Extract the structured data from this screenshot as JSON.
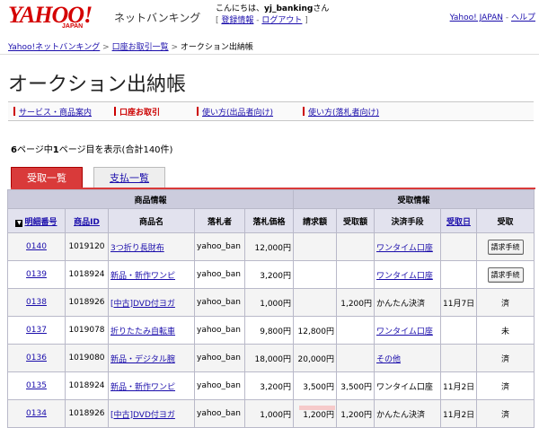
{
  "header": {
    "logo_text": "YAHOO!",
    "logo_sub": "JAPAN",
    "service_name": "ネットバンキング",
    "greeting_prefix": "こんにちは、",
    "user_name": "yj_banking",
    "greeting_suffix": "さん",
    "register_info": "登録情報",
    "logout": "ログアウト",
    "yahoo_japan_link": "Yahoo! JAPAN",
    "help_link": "ヘルプ"
  },
  "breadcrumb": {
    "home": "Yahoo!ネットバンキング",
    "account_list": "口座お取引一覧",
    "current": "オークション出納帳"
  },
  "page_title": "オークション出納帳",
  "menu": [
    {
      "label": "サービス・商品案内"
    },
    {
      "label": "口座お取引"
    },
    {
      "label": "使い方(出品者向け)"
    },
    {
      "label": "使い方(落札者向け)"
    }
  ],
  "page_info": {
    "total_pages": "6",
    "t1": "ページ中",
    "current_page": "1",
    "t2": "ページ目を表示(合計140件)"
  },
  "tabs": {
    "receipt": "受取一覧",
    "payment": "支払一覧"
  },
  "table": {
    "group_product": "商品情報",
    "group_receipt": "受取情報",
    "col_ledger": "明細番号",
    "col_product_id": "商品ID",
    "col_product_name": "商品名",
    "col_bidder": "落札者",
    "col_price": "落札価格",
    "col_billed": "請求額",
    "col_received": "受取額",
    "col_method": "決済手段",
    "col_date": "受取日",
    "col_status": "受取",
    "sort_marker": "▼",
    "rows": [
      {
        "ledger": "0140",
        "pid": "1019120",
        "name": "3つ折り長財布",
        "bidder": "yahoo_ban",
        "price": "12,000円",
        "billed": "",
        "received": "",
        "method": "ワンタイム口座",
        "method_link": true,
        "date": "",
        "status": "請求手続",
        "status_button": true
      },
      {
        "ledger": "0139",
        "pid": "1018924",
        "name": "新品・新作ワンピ",
        "bidder": "yahoo_ban",
        "price": "3,200円",
        "billed": "",
        "received": "",
        "method": "ワンタイム口座",
        "method_link": true,
        "date": "",
        "status": "請求手続",
        "status_button": true
      },
      {
        "ledger": "0138",
        "pid": "1018926",
        "name": "[中古]DVD付ヨガ",
        "bidder": "yahoo_ban",
        "price": "1,000円",
        "billed": "",
        "received": "1,200円",
        "method": "かんたん決済",
        "method_link": false,
        "date": "11月7日",
        "status": "済",
        "status_button": false
      },
      {
        "ledger": "0137",
        "pid": "1019078",
        "name": "折りたたみ自転車",
        "bidder": "yahoo_ban",
        "price": "9,800円",
        "billed": "12,800円",
        "received": "",
        "method": "ワンタイム口座",
        "method_link": true,
        "date": "",
        "status": "未",
        "status_button": false
      },
      {
        "ledger": "0136",
        "pid": "1019080",
        "name": "新品・デジタル腕",
        "bidder": "yahoo_ban",
        "price": "18,000円",
        "billed": "20,000円",
        "received": "",
        "method": "その他",
        "method_link": true,
        "date": "",
        "status": "済",
        "status_button": false
      },
      {
        "ledger": "0135",
        "pid": "1018924",
        "name": "新品・新作ワンピ",
        "bidder": "yahoo_ban",
        "price": "3,200円",
        "billed": "3,500円",
        "received": "3,500円",
        "method": "ワンタイム口座",
        "method_link": false,
        "date": "11月2日",
        "status": "済",
        "status_button": false
      },
      {
        "ledger": "0134",
        "pid": "1018926",
        "name": "[中古]DVD付ヨガ",
        "bidder": "yahoo_ban",
        "price": "1,000円",
        "billed": "1,200円",
        "received": "1,200円",
        "method": "かんたん決済",
        "method_link": false,
        "date": "11月2日",
        "status": "済",
        "status_button": false
      }
    ]
  },
  "colors": {
    "brand_red": "#d40000",
    "tab_red": "#d93a3a",
    "link_blue": "#1a0dab"
  }
}
